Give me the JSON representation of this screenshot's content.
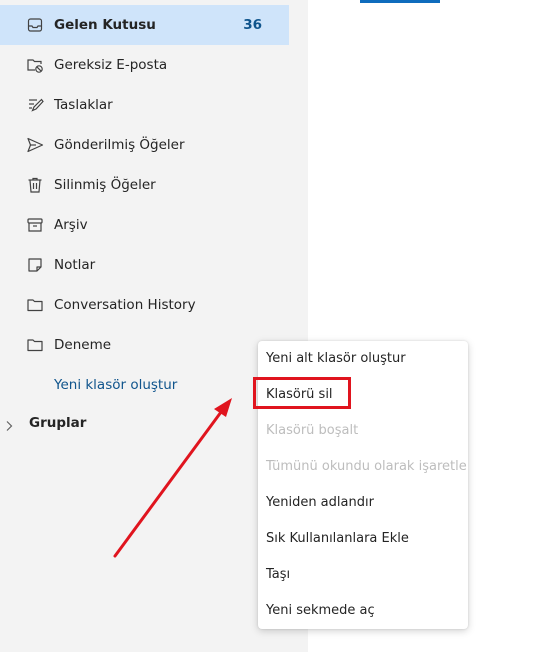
{
  "folders": [
    {
      "label": "Gelen Kutusu",
      "count": "36",
      "icon": "inbox-icon",
      "selected": true
    },
    {
      "label": "Gereksiz E-posta",
      "icon": "junk-folder-icon"
    },
    {
      "label": "Taslaklar",
      "icon": "drafts-pencil-icon"
    },
    {
      "label": "Gönderilmiş Öğeler",
      "icon": "send-icon"
    },
    {
      "label": "Silinmiş Öğeler",
      "icon": "trash-icon"
    },
    {
      "label": "Arşiv",
      "icon": "archive-icon"
    },
    {
      "label": "Notlar",
      "icon": "note-icon"
    },
    {
      "label": "Conversation History",
      "icon": "folder-icon"
    },
    {
      "label": "Deneme",
      "icon": "folder-icon"
    }
  ],
  "new_folder_label": "Yeni klasör oluştur",
  "groups_label": "Gruplar",
  "context_menu": {
    "items": [
      {
        "label": "Yeni alt klasör oluştur",
        "enabled": true
      },
      {
        "label": "Klasörü sil",
        "enabled": true,
        "highlighted": true
      },
      {
        "label": "Klasörü boşalt",
        "enabled": false
      },
      {
        "label": "Tümünü okundu olarak işaretle",
        "enabled": false
      },
      {
        "label": "Yeniden adlandır",
        "enabled": true
      },
      {
        "label": "Sık Kullanılanlara Ekle",
        "enabled": true
      },
      {
        "label": "Taşı",
        "enabled": true
      },
      {
        "label": "Yeni sekmede aç",
        "enabled": true
      }
    ]
  },
  "colors": {
    "selected_bg": "#cfe4fa",
    "accent": "#0f548c",
    "annotation_red": "#e0141e"
  }
}
